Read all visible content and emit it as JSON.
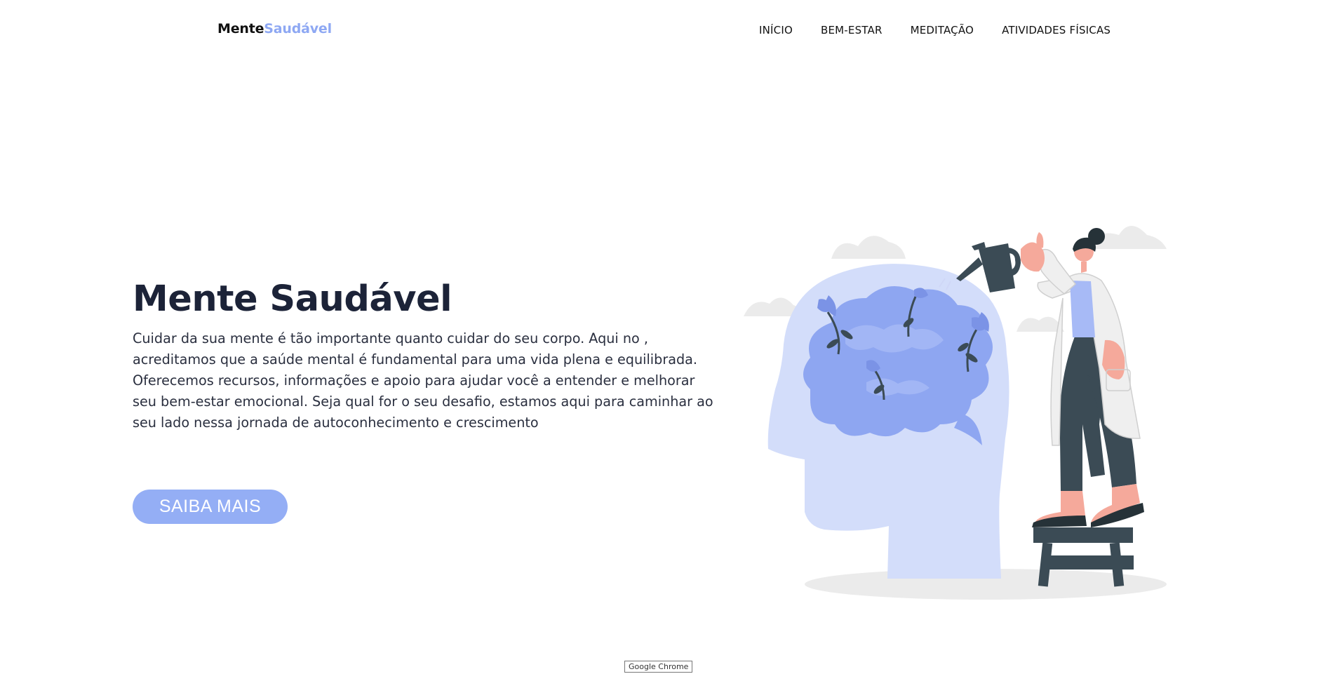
{
  "header": {
    "logo_main": "Mente",
    "logo_accent": "Saudável",
    "nav": [
      "INÍCIO",
      "BEM-ESTAR",
      "MEDITAÇÃO",
      "ATIVIDADES FÍSICAS"
    ]
  },
  "hero": {
    "title": "Mente Saudável",
    "paragraph": "Cuidar da sua mente é tão importante quanto cuidar do seu corpo. Aqui no , acreditamos que a saúde mental é fundamental para uma vida plena e equilibrada. Oferecemos recursos, informações e apoio para ajudar você a entender e melhorar seu bem-estar emocional. Seja qual for o seu desafio, estamos aqui para caminhar ao seu lado nessa jornada de autoconhecimento e crescimento",
    "cta_label": "SAIBA MAIS"
  },
  "footer_tag": "Google Chrome",
  "colors": {
    "accent": "#8ea8f3",
    "button": "#94aef5",
    "title": "#1c2338",
    "head_light": "#d3ddfa",
    "brain": "#8ea6f1",
    "dark_slate": "#3b4b55",
    "skin": "#f5a99b",
    "cloud": "#ebebeb"
  },
  "illustration": {
    "icon": "mental-health-illustration"
  }
}
